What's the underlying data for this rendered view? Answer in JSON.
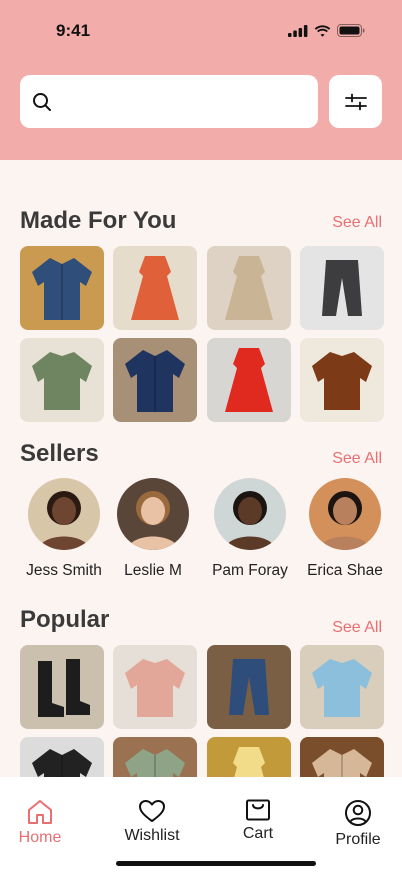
{
  "status_bar": {
    "time": "9:41"
  },
  "search": {
    "placeholder": ""
  },
  "sections": {
    "made_for_you": {
      "title": "Made For You",
      "see_all": "See All",
      "items": [
        {
          "icon": "blue-quilted-jacket",
          "color": "#2f4f7a",
          "bg": "#c99a4f"
        },
        {
          "icon": "floral-dress",
          "color": "#e0603a",
          "bg": "#e6dccc"
        },
        {
          "icon": "beige-dress",
          "color": "#c9b596",
          "bg": "#ddd2c3"
        },
        {
          "icon": "gray-trousers",
          "color": "#3d3d3f",
          "bg": "#e4e4e4"
        },
        {
          "icon": "green-sweater",
          "color": "#6f8561",
          "bg": "#e8e2d6"
        },
        {
          "icon": "navy-blazer",
          "color": "#1f3560",
          "bg": "#a89076"
        },
        {
          "icon": "red-dress",
          "color": "#e02a1f",
          "bg": "#d8d6d2"
        },
        {
          "icon": "brown-sweater",
          "color": "#7d3a17",
          "bg": "#efe8dc"
        }
      ]
    },
    "sellers": {
      "title": "Sellers",
      "see_all": "See All",
      "items": [
        {
          "name": "Jess Smith",
          "skin": "#6e4530",
          "hair": "#2a1a12",
          "bg": "#d8c6a8"
        },
        {
          "name": "Leslie M",
          "skin": "#e9c1a5",
          "hair": "#9a6a3c",
          "bg": "#5a4638"
        },
        {
          "name": "Pam Foray",
          "skin": "#5b3a28",
          "hair": "#1c1410",
          "bg": "#cfd6d6"
        },
        {
          "name": "Erica Shae",
          "skin": "#b9805e",
          "hair": "#1c1410",
          "bg": "#d4905a"
        }
      ]
    },
    "popular": {
      "title": "Popular",
      "see_all": "See All",
      "items": [
        {
          "icon": "black-boots",
          "color": "#1d1d1d",
          "bg": "#cbbfae"
        },
        {
          "icon": "pink-blouse",
          "color": "#e3a79a",
          "bg": "#e6dfd8"
        },
        {
          "icon": "denim-capris",
          "color": "#2e4d7a",
          "bg": "#7a5f45"
        },
        {
          "icon": "blue-knit-sweater",
          "color": "#8bbfdc",
          "bg": "#d9cdbc"
        },
        {
          "icon": "black-jacket",
          "color": "#222222",
          "bg": "#dcdcdc"
        },
        {
          "icon": "sage-shirt",
          "color": "#8fa486",
          "bg": "#9a7252"
        },
        {
          "icon": "yellow-cami",
          "color": "#f2dc8a",
          "bg": "#c29a3a"
        },
        {
          "icon": "tan-trench-coat",
          "color": "#d6b899",
          "bg": "#7a4e2a"
        }
      ]
    }
  },
  "tabs": [
    {
      "label": "Home",
      "icon": "home-icon",
      "active": true
    },
    {
      "label": "Wishlist",
      "icon": "heart-icon",
      "active": false
    },
    {
      "label": "Cart",
      "icon": "bag-icon",
      "active": false
    },
    {
      "label": "Profile",
      "icon": "profile-icon",
      "active": false
    }
  ],
  "colors": {
    "header": "#f2aca9",
    "accent": "#e86f72",
    "background": "#fcf4f1"
  }
}
